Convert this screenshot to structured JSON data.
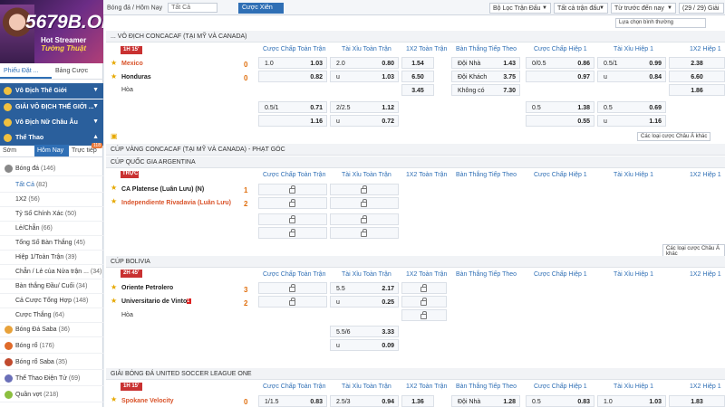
{
  "brand": {
    "logo": "5679B.ORG",
    "stream1": "Hot Streamer",
    "stream2": "Tường Thuật"
  },
  "top": {
    "crumb": "Bóng đá / Hôm Nay",
    "all": "Tất Cả",
    "xien": "Cược Xiên",
    "filter": "Bộ Lọc Trận Đấu",
    "allmatch": "Tất cả trận đấu",
    "sort": "Từ trước đến nay",
    "count": "(29 / 29) Giải",
    "choose": "Lựa chọn bình thường"
  },
  "left": {
    "tabs": [
      "Phiếu Đặt ...",
      "Bảng Cược"
    ],
    "nav": [
      "Vô Địch Thế Giới",
      "GIẢI VÔ ĐỊCH THẾ GIỚI ...",
      "Vô Địch Nữ Châu Âu",
      "Thể Thao"
    ],
    "subtabs": [
      "Sớm",
      "Hôm Nay",
      "Trực tiếp"
    ],
    "subbadge": "118",
    "items": [
      {
        "label": "Bóng đá",
        "count": "(146)"
      },
      {
        "label": "Tất Cả",
        "count": "(82)"
      },
      {
        "label": "1X2",
        "count": "(56)"
      },
      {
        "label": "Tỷ Số Chính Xác",
        "count": "(50)"
      },
      {
        "label": "Lẻ/Chẵn",
        "count": "(66)"
      },
      {
        "label": "Tổng Số Bàn Thắng",
        "count": "(45)"
      },
      {
        "label": "Hiệp 1/Toàn Trận",
        "count": "(39)"
      },
      {
        "label": "Chẵn / Lẻ của Nửa trận ...",
        "count": "(34)"
      },
      {
        "label": "Bàn thắng Đầu/ Cuối",
        "count": "(34)"
      },
      {
        "label": "Cả Cược Tổng Hợp",
        "count": "(148)"
      },
      {
        "label": "Cược Thắng",
        "count": "(64)"
      },
      {
        "label": "Bóng Đá Saba",
        "count": "(36)"
      },
      {
        "label": "Bóng rổ",
        "count": "(176)"
      },
      {
        "label": "Bóng rổ Saba",
        "count": "(35)"
      },
      {
        "label": "Thể Thao Điện Tử",
        "count": "(69)"
      },
      {
        "label": "Quần vợt",
        "count": "(218)"
      }
    ]
  },
  "cols": [
    "Cược Chấp Toàn Trận",
    "Tài Xỉu Toàn Trận",
    "1X2 Toàn Trận",
    "Bàn Thắng Tiếp Theo",
    "Cược Chấp Hiệp 1",
    "Tài Xỉu Hiệp 1",
    "1X2 Hiệp 1"
  ],
  "l1": {
    "name": "... VÔ ĐỊCH CONCACAF (TẠI MỸ VÀ CANADA)",
    "time": "1H 15'",
    "t1": "Mexico",
    "t2": "Honduras",
    "draw": "Hòa",
    "s1": "0",
    "s2": "0",
    "r1": [
      "1.0",
      "1.03",
      "2.0",
      "0.80",
      "1.54",
      "Đội Nhà",
      "1.43",
      "0/0.5",
      "0.86",
      "0.5/1",
      "0.99",
      "2.38"
    ],
    "r2": [
      "0.82",
      "u",
      "1.03",
      "6.50",
      "Đội Khách",
      "3.75",
      "0.97",
      "u",
      "0.84",
      "6.60"
    ],
    "r3": [
      "3.45",
      "Không có",
      "7.30",
      "1.86"
    ],
    "r4": [
      "0.5/1",
      "0.71",
      "2/2.5",
      "1.12",
      "0.5",
      "1.38",
      "0.5",
      "0.69"
    ],
    "r5": [
      "1.16",
      "u",
      "0.72",
      "0.55",
      "u",
      "1.16"
    ],
    "more": "Các loại cược Châu Á khác"
  },
  "l2": {
    "name": "CÚP VÀNG CONCACAF (TẠI MỸ VÀ CANADA) - PHẠT GÓC"
  },
  "l3": {
    "name": "CÚP QUỐC GIA ARGENTINA",
    "live": "TRỰC",
    "t1": "CA Platense (Luân Lưu) (N)",
    "t2": "Independiente Rivadavia (Luân Lưu)",
    "s1": "1",
    "s2": "2",
    "more": "Các loại cược Châu Á khác"
  },
  "l4": {
    "name": "CÚP BOLIVIA",
    "time": "2H 45'",
    "t1": "Oriente Petrolero",
    "t2": "Universitario de Vinto",
    "draw": "Hòa",
    "s1": "3",
    "s2": "2",
    "redcard": "1",
    "r1": [
      "5.5",
      "2.17"
    ],
    "r2": [
      "u",
      "0.25"
    ],
    "r3": [
      "5.5/6",
      "3.33"
    ],
    "r4": [
      "u",
      "0.09"
    ]
  },
  "l5": {
    "name": "GIẢI BÓNG ĐÁ UNITED SOCCER LEAGUE ONE",
    "time": "1H 15'",
    "t1": "Spokane Velocity",
    "s1": "0",
    "r1": [
      "1/1.5",
      "0.83",
      "2.5/3",
      "0.94",
      "1.36",
      "Đội Nhà",
      "1.28",
      "0.5",
      "0.83",
      "1.0",
      "1.03",
      "1.83"
    ]
  },
  "colors": {
    "accent": "#2f6fb5",
    "nav": "#2a5f9c",
    "live": "#c93131",
    "score": "#e07010"
  }
}
